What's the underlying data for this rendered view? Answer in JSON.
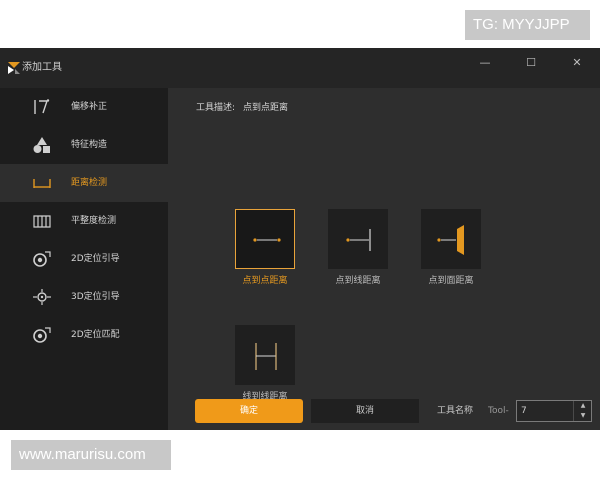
{
  "watermarks": {
    "top": "TG: MYYJJPP",
    "bottom": "www.marurisu.com"
  },
  "window": {
    "title": "添加工具",
    "controls": {
      "minimize": "—",
      "maximize": "☐",
      "close": "✕"
    }
  },
  "sidebar": {
    "active_index": 2,
    "items": [
      {
        "label": "偏移补正",
        "icon": "offset-correction-icon"
      },
      {
        "label": "特征构造",
        "icon": "feature-shapes-icon"
      },
      {
        "label": "距离检测",
        "icon": "distance-measure-icon"
      },
      {
        "label": "平整度检测",
        "icon": "flatness-icon"
      },
      {
        "label": "2D定位引导",
        "icon": "2d-guide-icon"
      },
      {
        "label": "3D定位引导",
        "icon": "3d-guide-icon"
      },
      {
        "label": "2D定位匹配",
        "icon": "2d-match-icon"
      }
    ]
  },
  "content": {
    "description_label": "工具描述:",
    "description_value": "点到点距离",
    "tools": [
      {
        "label": "点到点距离",
        "icon": "point-to-point-icon"
      },
      {
        "label": "点到线距离",
        "icon": "point-to-line-icon"
      },
      {
        "label": "点到面距离",
        "icon": "point-to-plane-icon"
      },
      {
        "label": "线到线距离",
        "icon": "line-to-line-icon"
      }
    ],
    "active_tool_index": 0
  },
  "footer": {
    "ok_label": "确定",
    "cancel_label": "取消",
    "name_label": "工具名称",
    "name_prefix": "Tool-",
    "name_value": "7",
    "spin_up": "▲",
    "spin_down": "▼"
  },
  "colors": {
    "accent": "#f09a19",
    "sidebar_bg": "#1d1d1d",
    "panel_bg": "#2e2e2e",
    "titlebar_bg": "#252525"
  }
}
